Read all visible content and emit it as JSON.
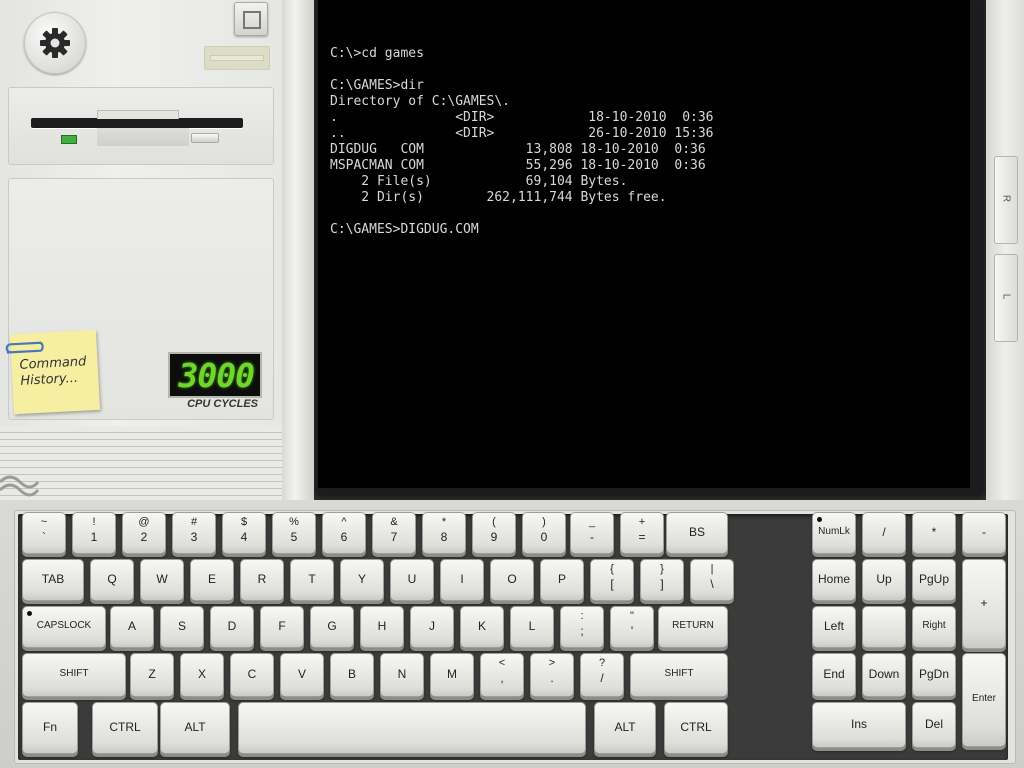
{
  "case": {
    "sticky_note": "Command\nHistory...",
    "cpu_cycles_value": "3000",
    "cpu_cycles_label": "CPU CYCLES"
  },
  "side_buttons": {
    "right": "R",
    "left": "L"
  },
  "terminal": {
    "lines": [
      "C:\\>cd games",
      "",
      "C:\\GAMES>dir",
      "Directory of C:\\GAMES\\.",
      ".               <DIR>            18-10-2010  0:36",
      "..              <DIR>            26-10-2010 15:36",
      "DIGDUG   COM             13,808 18-10-2010  0:36",
      "MSPACMAN COM             55,296 18-10-2010  0:36",
      "    2 File(s)            69,104 Bytes.",
      "    2 Dir(s)        262,111,744 Bytes free.",
      "",
      "C:\\GAMES>DIGDUG.COM"
    ]
  },
  "keyboard": {
    "row1": [
      {
        "top": "~",
        "bot": "`"
      },
      {
        "top": "!",
        "bot": "1"
      },
      {
        "top": "@",
        "bot": "2"
      },
      {
        "top": "#",
        "bot": "3"
      },
      {
        "top": "$",
        "bot": "4"
      },
      {
        "top": "%",
        "bot": "5"
      },
      {
        "top": "^",
        "bot": "6"
      },
      {
        "top": "&",
        "bot": "7"
      },
      {
        "top": "*",
        "bot": "8"
      },
      {
        "top": "(",
        "bot": "9"
      },
      {
        "top": ")",
        "bot": "0"
      },
      {
        "top": "_",
        "bot": "-"
      },
      {
        "top": "+",
        "bot": "="
      },
      {
        "label": "BS"
      }
    ],
    "row2": [
      {
        "label": "TAB"
      },
      {
        "label": "Q"
      },
      {
        "label": "W"
      },
      {
        "label": "E"
      },
      {
        "label": "R"
      },
      {
        "label": "T"
      },
      {
        "label": "Y"
      },
      {
        "label": "U"
      },
      {
        "label": "I"
      },
      {
        "label": "O"
      },
      {
        "label": "P"
      },
      {
        "top": "{",
        "bot": "["
      },
      {
        "top": "}",
        "bot": "]"
      },
      {
        "top": "|",
        "bot": "\\"
      }
    ],
    "row3": [
      {
        "label": "CAPSLOCK"
      },
      {
        "label": "A"
      },
      {
        "label": "S"
      },
      {
        "label": "D"
      },
      {
        "label": "F"
      },
      {
        "label": "G"
      },
      {
        "label": "H"
      },
      {
        "label": "J"
      },
      {
        "label": "K"
      },
      {
        "label": "L"
      },
      {
        "top": ":",
        "bot": ";"
      },
      {
        "top": "\"",
        "bot": "'"
      },
      {
        "label": "RETURN"
      }
    ],
    "row4": [
      {
        "label": "SHIFT"
      },
      {
        "label": "Z"
      },
      {
        "label": "X"
      },
      {
        "label": "C"
      },
      {
        "label": "V"
      },
      {
        "label": "B"
      },
      {
        "label": "N"
      },
      {
        "label": "M"
      },
      {
        "top": "<",
        "bot": ","
      },
      {
        "top": ">",
        "bot": "."
      },
      {
        "top": "?",
        "bot": "/"
      },
      {
        "label": "SHIFT"
      }
    ],
    "row5": [
      {
        "label": "Fn"
      },
      {
        "label": "CTRL"
      },
      {
        "label": "ALT"
      },
      {
        "label": ""
      },
      {
        "label": "ALT"
      },
      {
        "label": "CTRL"
      }
    ],
    "numpad": [
      {
        "label": "NumLk"
      },
      {
        "label": "/"
      },
      {
        "label": "*"
      },
      {
        "label": "-"
      },
      {
        "label": "Home"
      },
      {
        "label": "Up"
      },
      {
        "label": "PgUp"
      },
      {
        "label": "+"
      },
      {
        "label": "Left"
      },
      {
        "label": ""
      },
      {
        "label": "Right"
      },
      {
        "label": "End"
      },
      {
        "label": "Down"
      },
      {
        "label": "PgDn"
      },
      {
        "label": "Enter"
      },
      {
        "label": "Ins"
      },
      {
        "label": "Del"
      }
    ]
  }
}
